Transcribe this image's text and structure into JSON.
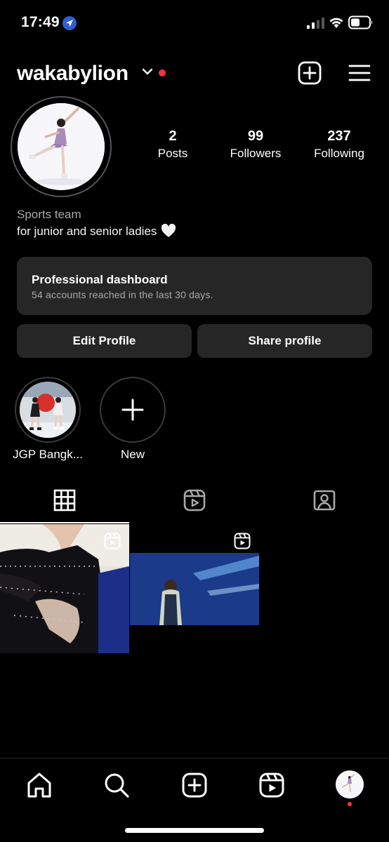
{
  "status_bar": {
    "time": "17:49",
    "icons": [
      "location-arrow-icon",
      "cellular-signal-icon",
      "wifi-icon",
      "battery-icon"
    ]
  },
  "header": {
    "username": "wakabylion",
    "icons": [
      "chevron-down-icon",
      "new-post-icon",
      "hamburger-menu-icon"
    ]
  },
  "stats": [
    {
      "value": "2",
      "label": "Posts"
    },
    {
      "value": "99",
      "label": "Followers"
    },
    {
      "value": "237",
      "label": "Following"
    }
  ],
  "bio": {
    "category": "Sports team",
    "text": "for junior and senior ladies"
  },
  "dashboard": {
    "title": "Professional dashboard",
    "subtitle": "54 accounts reached in the last 30 days."
  },
  "buttons": {
    "edit": "Edit Profile",
    "share": "Share profile"
  },
  "highlights": [
    {
      "label": "JGP Bangk..."
    },
    {
      "label": "New"
    }
  ],
  "tabs": [
    "grid-icon",
    "reels-icon",
    "tagged-icon"
  ],
  "nav": [
    "home-icon",
    "search-icon",
    "create-icon",
    "reels-icon",
    "profile-avatar"
  ],
  "colors": {
    "background": "#000000",
    "surface": "#262626",
    "secondary_text": "#a8a8a8",
    "notification": "#ff3040"
  }
}
